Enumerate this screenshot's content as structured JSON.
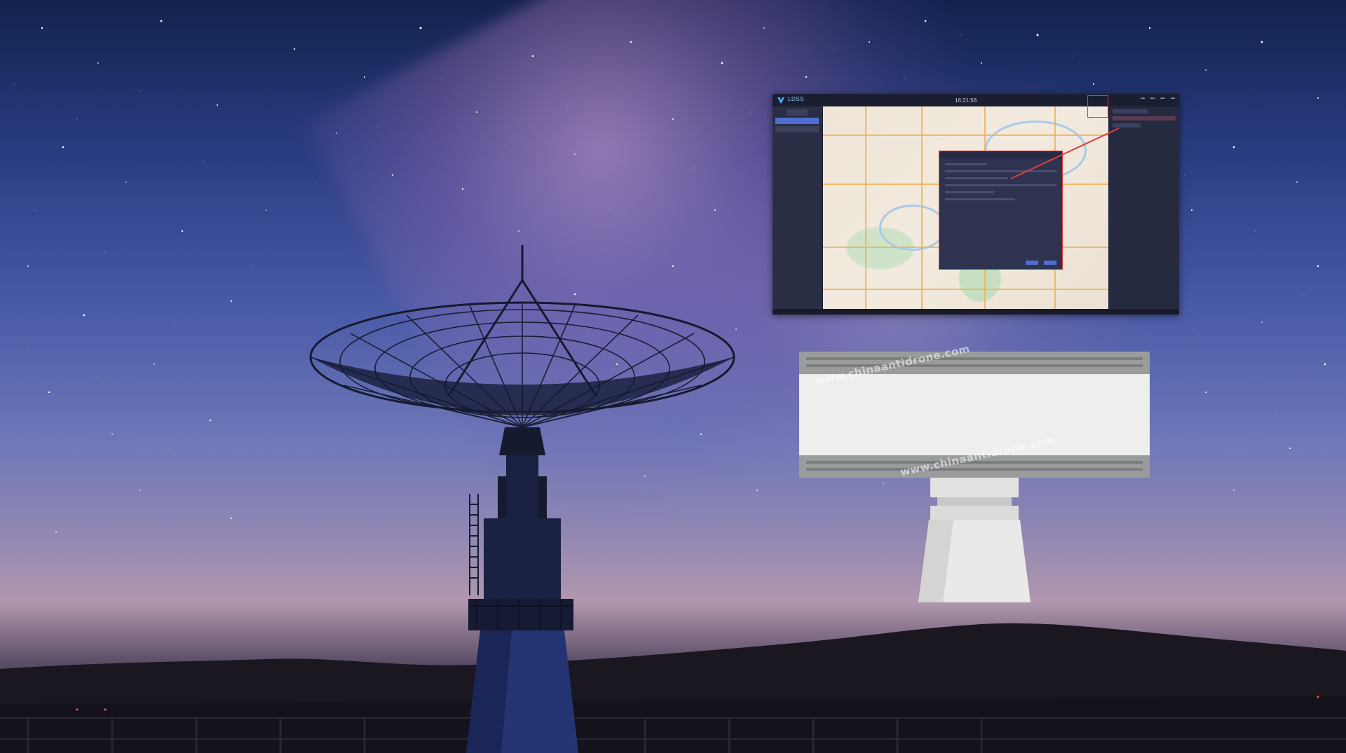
{
  "overlay_ui": {
    "title": "LDSS",
    "time": "16:21:56"
  },
  "watermarks": [
    "www.chinaantidrone.com",
    "www.chinaantidrone.com"
  ],
  "colors": {
    "sky_top": "#12224e",
    "sky_mid": "#4b5ca8",
    "horizon_glow": "#b197ad",
    "ground": "#1f1a24",
    "highlight_red": "#e23b3b"
  }
}
